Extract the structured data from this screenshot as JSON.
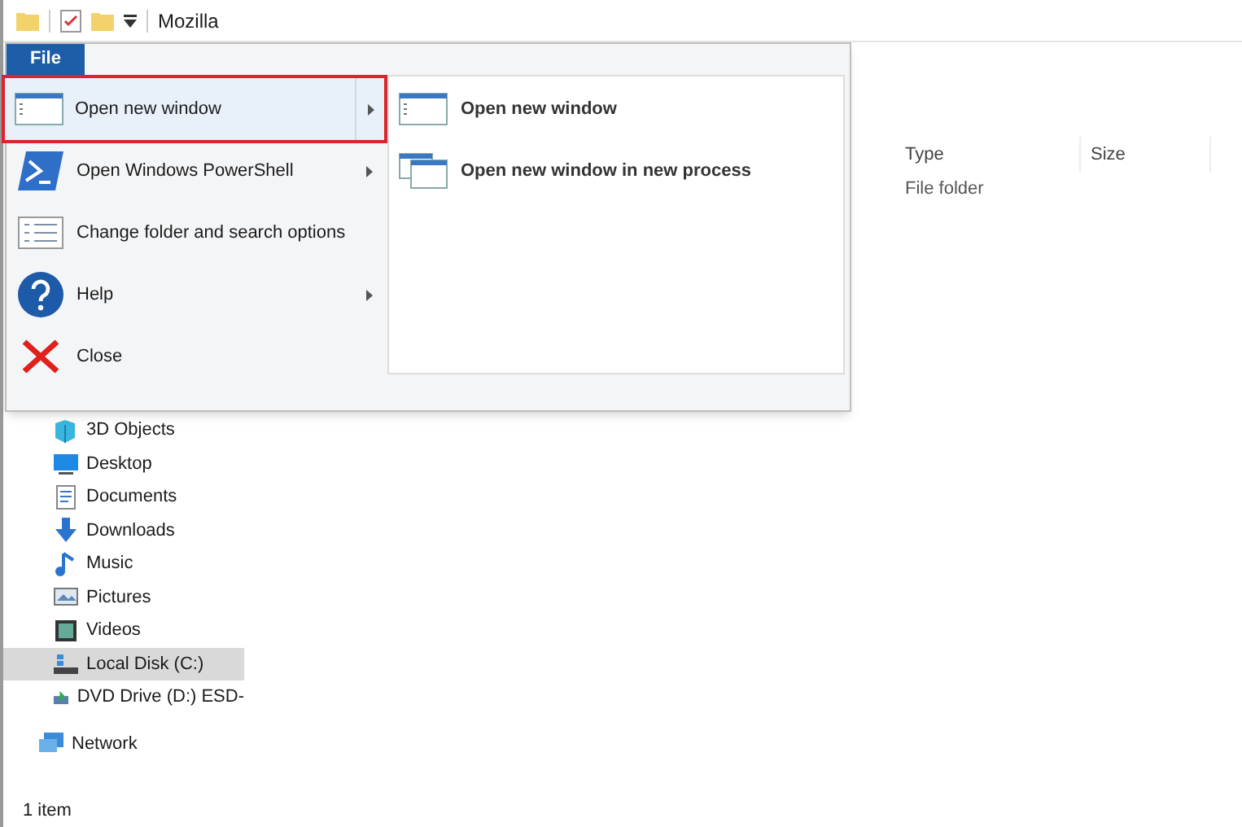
{
  "title_bar": {
    "title": "Mozilla"
  },
  "file_menu": {
    "tab": "File",
    "items": [
      {
        "label": "Open new window",
        "has_submenu": true,
        "selected": true
      },
      {
        "label": "Open Windows PowerShell",
        "has_submenu": true,
        "selected": false
      },
      {
        "label": "Change folder and search options",
        "has_submenu": false,
        "selected": false
      },
      {
        "label": "Help",
        "has_submenu": true,
        "selected": false
      },
      {
        "label": "Close",
        "has_submenu": false,
        "selected": false
      }
    ],
    "submenu": [
      {
        "label": "Open new window"
      },
      {
        "label": "Open new window in new process"
      }
    ]
  },
  "columns": [
    "Type",
    "Size"
  ],
  "rows": [
    {
      "type": "File folder"
    }
  ],
  "nav": [
    {
      "label": "3D Objects",
      "kind": "folder",
      "selected": false
    },
    {
      "label": "Desktop",
      "kind": "folder",
      "selected": false
    },
    {
      "label": "Documents",
      "kind": "folder",
      "selected": false
    },
    {
      "label": "Downloads",
      "kind": "folder",
      "selected": false
    },
    {
      "label": "Music",
      "kind": "folder",
      "selected": false
    },
    {
      "label": "Pictures",
      "kind": "folder",
      "selected": false
    },
    {
      "label": "Videos",
      "kind": "folder",
      "selected": false
    },
    {
      "label": "Local Disk (C:)",
      "kind": "folder",
      "selected": true
    },
    {
      "label": "DVD Drive (D:) ESD-",
      "kind": "folder",
      "selected": false
    },
    {
      "label": "Network",
      "kind": "location",
      "selected": false
    }
  ],
  "status_bar": {
    "text": "1 item"
  }
}
